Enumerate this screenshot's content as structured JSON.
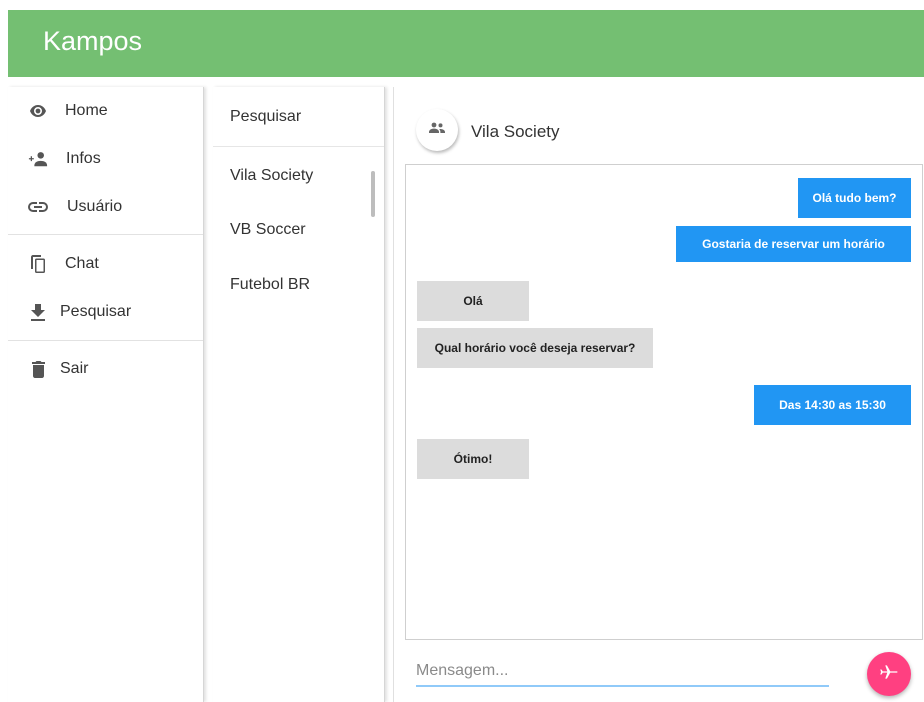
{
  "app": {
    "title": "Kampos"
  },
  "sidebar": {
    "items": [
      {
        "label": "Home",
        "icon": "eye-icon"
      },
      {
        "label": "Infos",
        "icon": "person-add-icon"
      },
      {
        "label": "Usuário",
        "icon": "link-icon"
      },
      {
        "label": "Chat",
        "icon": "copy-icon"
      },
      {
        "label": "Pesquisar",
        "icon": "download-icon"
      },
      {
        "label": "Sair",
        "icon": "trash-icon"
      }
    ]
  },
  "contacts": {
    "search_label": "Pesquisar",
    "items": [
      "Vila Society",
      "VB Soccer",
      "Futebol BR"
    ]
  },
  "chat": {
    "title": "Vila Society",
    "messages": [
      {
        "text": "Olá tudo bem?",
        "from": "me"
      },
      {
        "text": "Gostaria de reservar um horário",
        "from": "me"
      },
      {
        "text": "Olá",
        "from": "them"
      },
      {
        "text": "Qual horário você deseja reservar?",
        "from": "them"
      },
      {
        "text": "Das 14:30 as 15:30",
        "from": "me"
      },
      {
        "text": "Ótimo!",
        "from": "them"
      }
    ],
    "input_placeholder": "Mensagem..."
  },
  "colors": {
    "topbar": "#74bf72",
    "outgoing": "#2196f3",
    "incoming": "#dcdcdc",
    "send_button": "#ff4081"
  }
}
